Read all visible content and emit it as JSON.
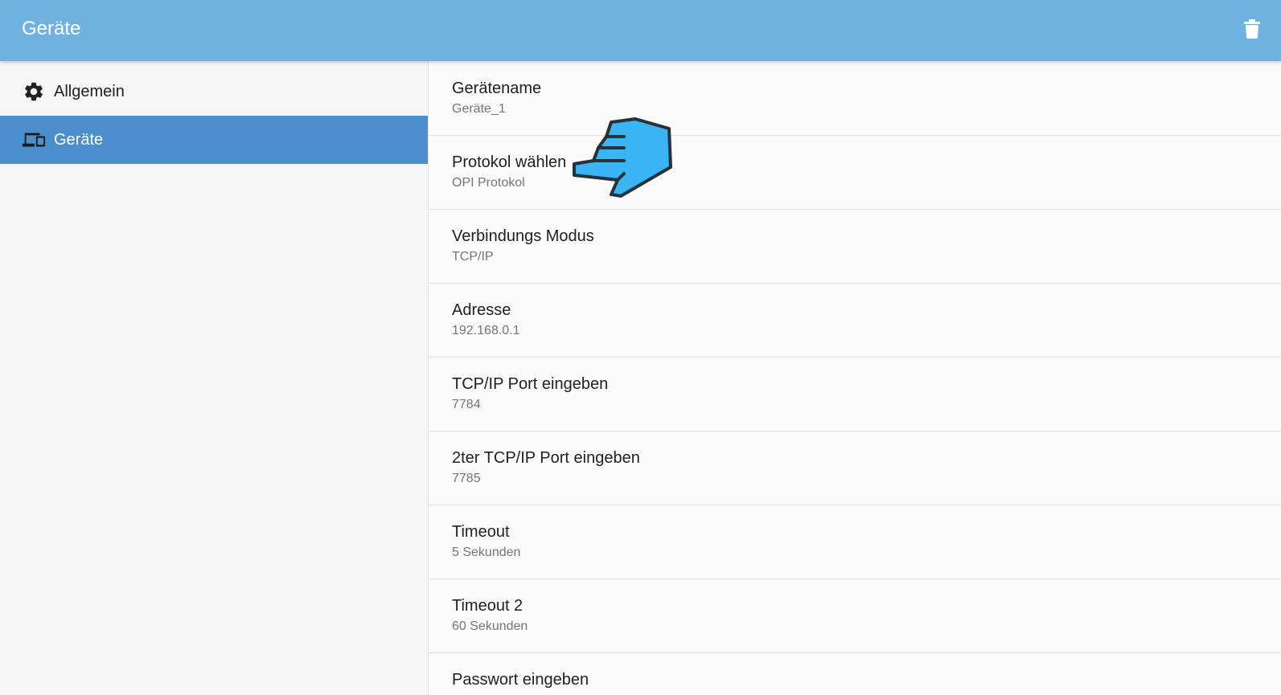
{
  "appbar": {
    "title": "Geräte",
    "delete_icon": "trash-icon",
    "color": "#6fb1e0"
  },
  "sidebar": {
    "items": [
      {
        "label": "Allgemein",
        "icon": "gear-icon",
        "active": false
      },
      {
        "label": "Geräte",
        "icon": "devices-icon",
        "active": true
      }
    ],
    "active_color": "#4a8fcc"
  },
  "preferences": [
    {
      "title": "Gerätename",
      "summary": "Geräte_1"
    },
    {
      "title": "Protokol wählen",
      "summary": "OPI Protokol"
    },
    {
      "title": "Verbindungs Modus",
      "summary": "TCP/IP"
    },
    {
      "title": "Adresse",
      "summary": "192.168.0.1"
    },
    {
      "title": "TCP/IP Port eingeben",
      "summary": "7784"
    },
    {
      "title": "2ter TCP/IP Port eingeben",
      "summary": "7785"
    },
    {
      "title": "Timeout",
      "summary": "5 Sekunden"
    },
    {
      "title": "Timeout 2",
      "summary": "60 Sekunden"
    },
    {
      "title": "Passwort eingeben",
      "summary": ""
    }
  ],
  "overlay": {
    "icon": "pointing-hand-icon",
    "color": "#3ab4f2"
  }
}
